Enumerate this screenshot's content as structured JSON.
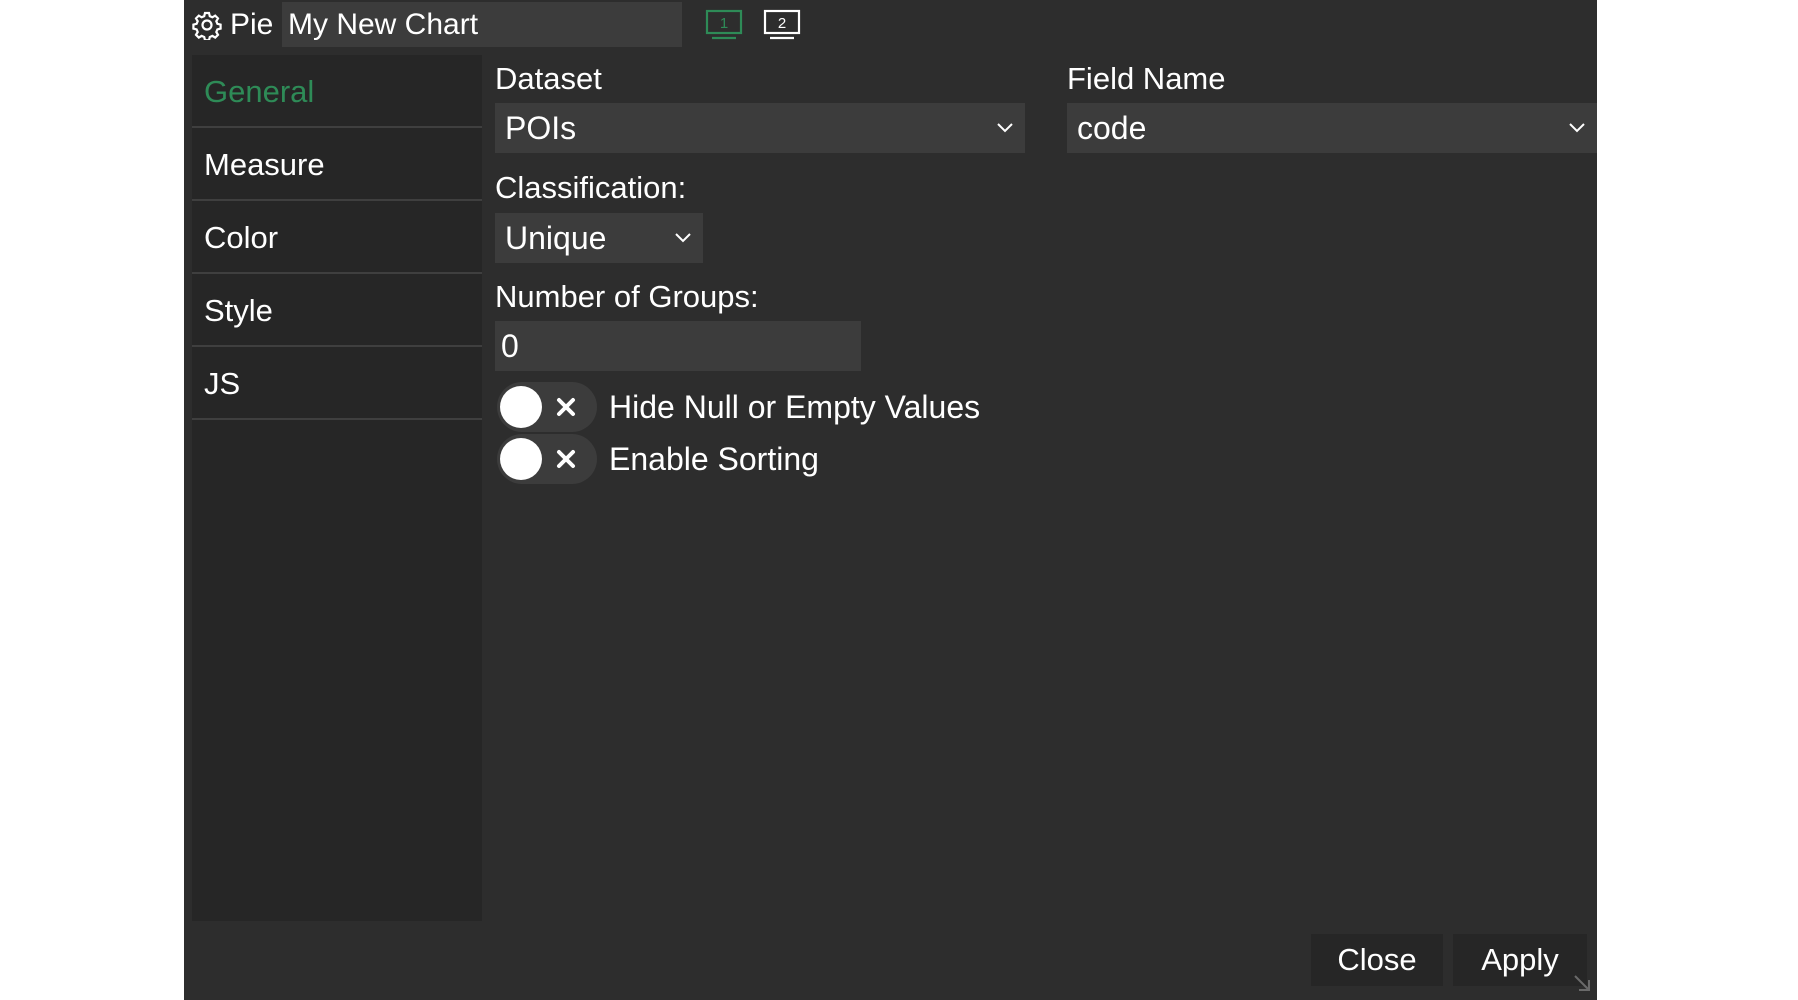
{
  "header": {
    "settings_icon": "gear-icon",
    "chart_type": "Pie",
    "chart_title": "My New Chart",
    "screen_buttons": [
      {
        "label": "1",
        "icon": "monitor-icon",
        "color": "#2e8b57"
      },
      {
        "label": "2",
        "icon": "monitor-icon",
        "color": "#ffffff"
      }
    ]
  },
  "sidebar": {
    "items": [
      {
        "label": "General",
        "active": true
      },
      {
        "label": "Measure"
      },
      {
        "label": "Color"
      },
      {
        "label": "Style"
      },
      {
        "label": "JS"
      }
    ]
  },
  "form": {
    "dataset_label": "Dataset",
    "dataset_value": "POIs",
    "field_name_label": "Field Name",
    "field_name_value": "code",
    "classification_label": "Classification:",
    "classification_value": "Unique",
    "groups_label": "Number of Groups:",
    "groups_value": "0",
    "toggles": [
      {
        "label": "Hide Null or Empty Values",
        "checked": false
      },
      {
        "label": "Enable Sorting",
        "checked": false
      }
    ]
  },
  "footer": {
    "close_label": "Close",
    "apply_label": "Apply"
  },
  "colors": {
    "accent": "#2e8b57",
    "panel": "#2d2d2d",
    "sidebar": "#262626",
    "input": "#3c3c3c"
  }
}
